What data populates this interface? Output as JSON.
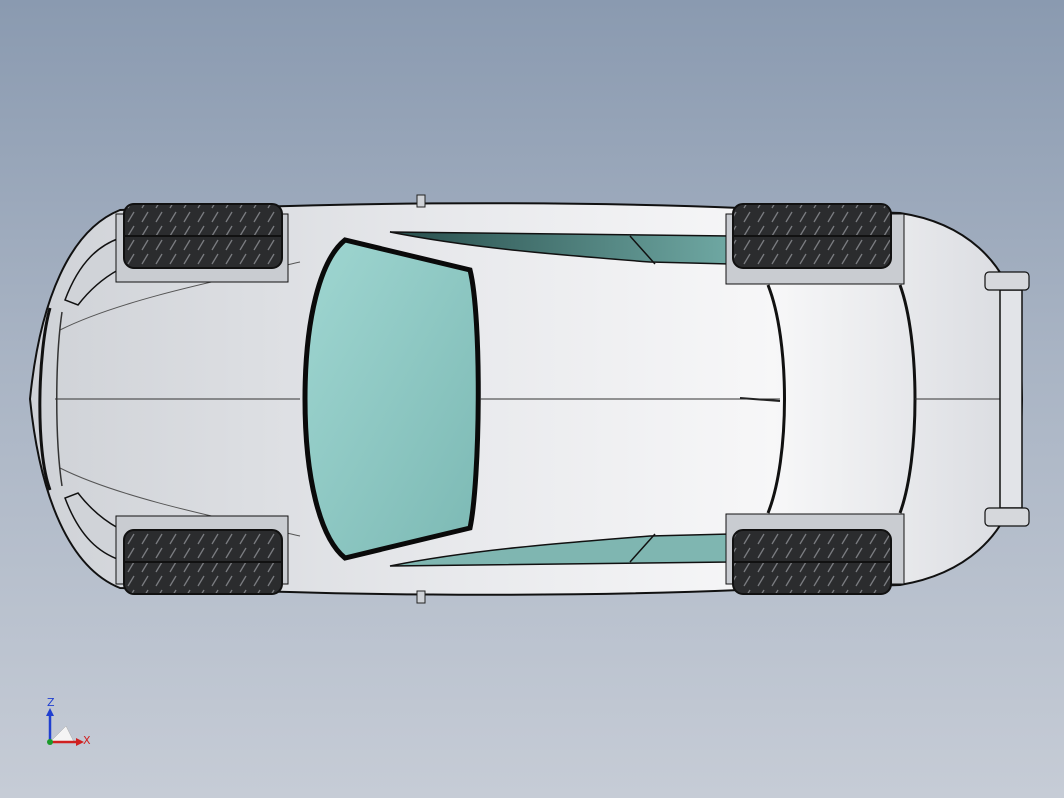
{
  "viewport": {
    "background_top": "#8a9ab0",
    "background_bottom": "#c6ccd6"
  },
  "model": {
    "body_color": "#e4e6ea",
    "glass_color": "#8fc8c4",
    "tire_color": "#2a2b2d",
    "outline_color": "#111111"
  },
  "triad": {
    "z_label": "Z",
    "x_label": "X",
    "z_color": "#1f3fd0",
    "x_color": "#d02020",
    "y_color": "#1a9a2a"
  }
}
